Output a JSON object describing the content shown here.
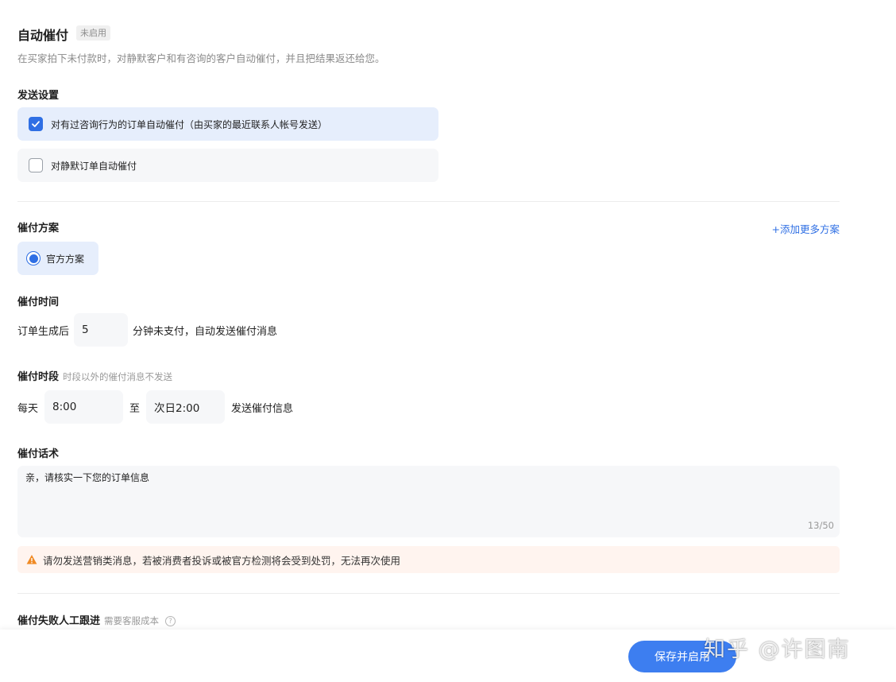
{
  "header": {
    "title": "自动催付",
    "status_badge": "未启用",
    "description": "在买家拍下未付款时，对静默客户和有咨询的客户自动催付，并且把结果返还给您。"
  },
  "send_settings": {
    "title": "发送设置",
    "options": [
      {
        "label": "对有过咨询行为的订单自动催付（由买家的最近联系人帐号发送）",
        "checked": true
      },
      {
        "label": "对静默订单自动催付",
        "checked": false
      }
    ]
  },
  "plan": {
    "title": "催付方案",
    "add_link": "+添加更多方案",
    "selected": "官方方案"
  },
  "timing": {
    "title": "催付时间",
    "prefix": "订单生成后",
    "minutes": "5",
    "suffix": "分钟未支付，自动发送催付消息"
  },
  "period": {
    "title": "催付时段",
    "hint": "时段以外的催付消息不发送",
    "prefix": "每天",
    "start": "8:00",
    "to": "至",
    "end": "次日2:00",
    "suffix": "发送催付信息"
  },
  "script": {
    "title": "催付话术",
    "text": "亲，请核实一下您的订单信息",
    "counter": "13/50"
  },
  "warning": {
    "text": "请勿发送营销类消息，若被消费者投诉或被官方检测将会受到处罚，无法再次使用"
  },
  "fallback": {
    "title": "催付失败人工跟进",
    "hint": "需要客服成本"
  },
  "footer": {
    "save_label": "保存并启用",
    "watermark": "知乎 @许图南"
  },
  "colors": {
    "accent": "#2f6fe4",
    "button": "#3d7ef0",
    "warning": "#f08a24"
  }
}
